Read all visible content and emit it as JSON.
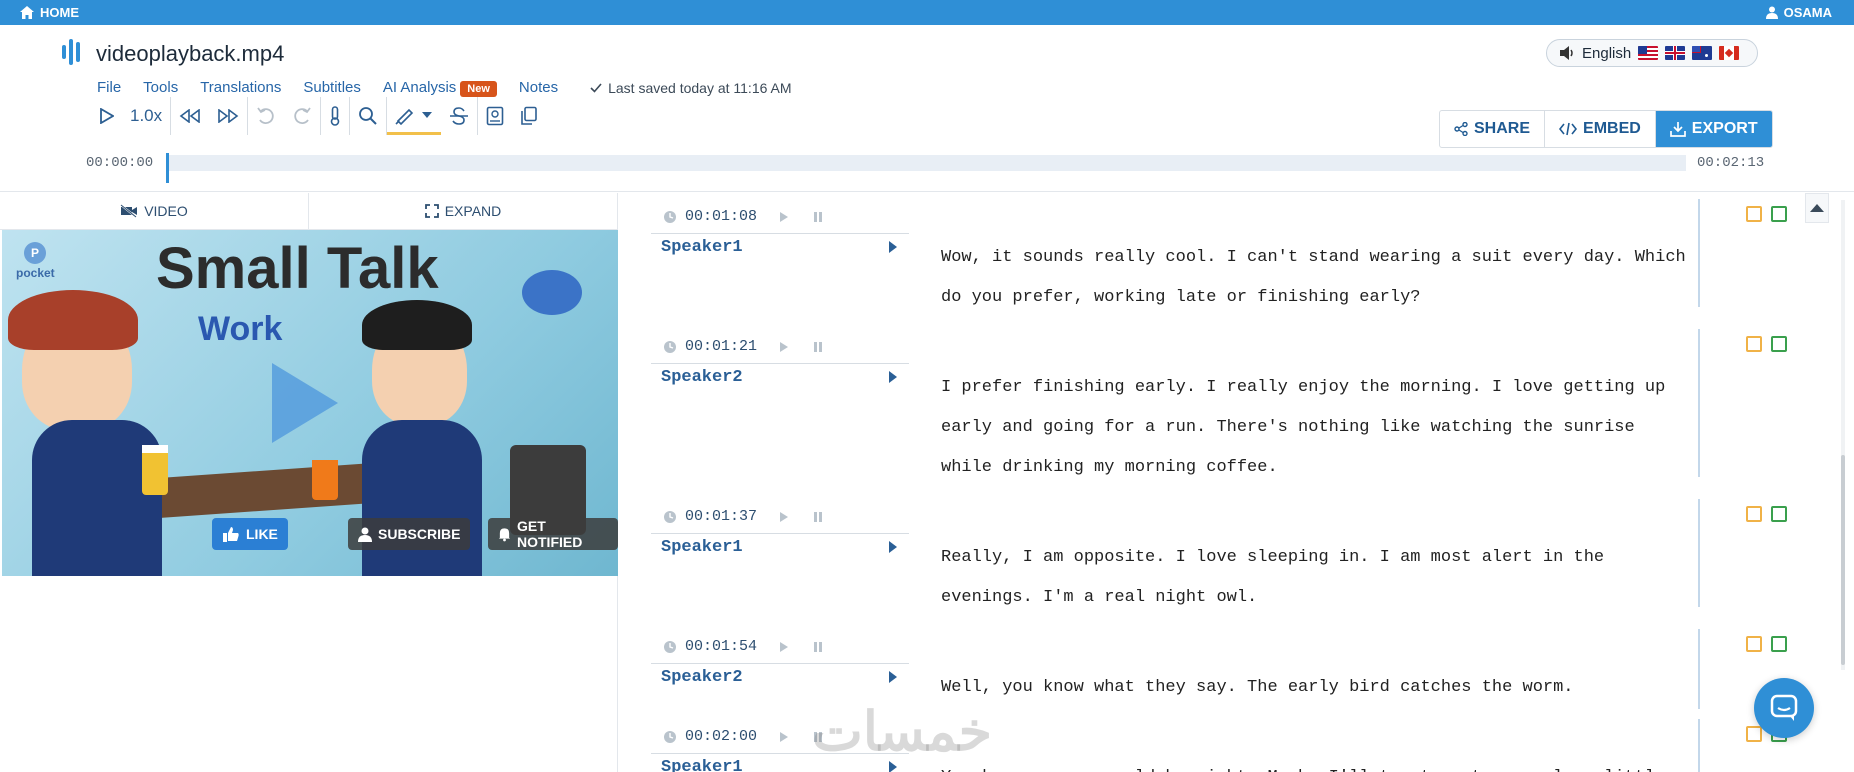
{
  "topbar": {
    "home_label": "HOME",
    "user_label": "OSAMA"
  },
  "header": {
    "filename": "videoplayback.mp4",
    "language": "English",
    "menu": [
      {
        "label": "File"
      },
      {
        "label": "Tools"
      },
      {
        "label": "Translations"
      },
      {
        "label": "Subtitles"
      },
      {
        "label": "AI Analysis"
      },
      {
        "label": "Notes"
      }
    ],
    "ai_badge": "New",
    "saved_status": "Last saved today at 11:16 AM",
    "speed": "1.0x",
    "actions": {
      "share": "SHARE",
      "embed": "EMBED",
      "export": "EXPORT"
    },
    "timeline_start": "00:00:00",
    "timeline_end": "00:02:13",
    "timeline_progress": 0.0
  },
  "left_panel": {
    "tabs": {
      "video": "VIDEO",
      "expand": "EXPAND"
    },
    "video_thumbnail": {
      "title": "Small Talk",
      "subtitle": "Work",
      "brand": "pocket",
      "buttons": {
        "like": "LIKE",
        "subscribe": "SUBSCRIBE",
        "notify": "GET NOTIFIED"
      }
    }
  },
  "transcript": [
    {
      "time": "00:01:08",
      "speaker": "Speaker1",
      "text": "Wow, it sounds really cool. I can't stand wearing a suit every day. Which do you prefer, working late or finishing early?"
    },
    {
      "time": "00:01:21",
      "speaker": "Speaker2",
      "text": "I prefer finishing early. I really enjoy the morning. I love getting up early and going for a run. There's nothing like watching the sunrise while drinking my morning coffee."
    },
    {
      "time": "00:01:37",
      "speaker": "Speaker1",
      "text": "Really, I am opposite. I love sleeping in. I am most alert in the evenings. I'm a real night owl."
    },
    {
      "time": "00:01:54",
      "speaker": "Speaker2",
      "text": "Well, you know what they say. The early bird catches the worm."
    },
    {
      "time": "00:02:00",
      "speaker": "Speaker1",
      "text": "You know... you could be right. Maybe I'll try to get up early a little"
    }
  ],
  "watermark": "خمسات",
  "colors": {
    "accent": "#2f8fd6",
    "badge": "#d7541b",
    "note": "#f0b247",
    "check": "#3aa04d"
  }
}
